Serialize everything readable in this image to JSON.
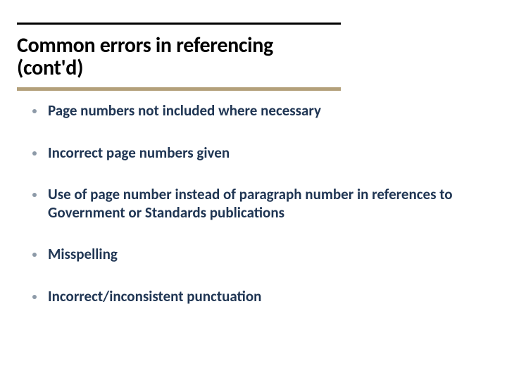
{
  "title": "Common errors in referencing (cont'd)",
  "bullets": [
    "Page numbers not included where necessary",
    "Incorrect page numbers given",
    "Use of page number instead of paragraph number in references to Government or Standards publications",
    "Misspelling",
    "Incorrect/inconsistent punctuation"
  ]
}
